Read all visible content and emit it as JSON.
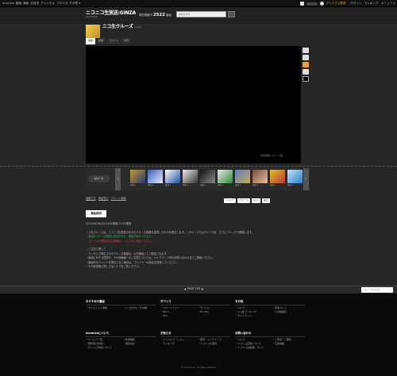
{
  "globalbar": {
    "left_links": [
      "niconico",
      "動画",
      "静画",
      "生放送",
      "チャンネル",
      "ブロマガ",
      "その他 ▾"
    ],
    "premium": "プレミアム登録",
    "login": "ログイン",
    "right_links": [
      "ログイン",
      "ランキング",
      "メニュー ▾"
    ]
  },
  "header": {
    "logo": "ニコニコ生放送:GINZA",
    "logo_sub": "nicolive β",
    "viewers_label": "現在視聴中",
    "viewers_count": "2522",
    "viewers_unit": "番組",
    "search_placeholder": "番組を探す"
  },
  "program": {
    "title": "ニコ生クルーズ",
    "title_sub": "(公式)",
    "meta": "",
    "tabs": [
      "番組",
      "詳細",
      "コメント",
      "共有"
    ]
  },
  "player": {
    "meta": "来場者数 コメント数"
  },
  "strip": {
    "lead_label": "番組一覧",
    "items": [
      {
        "cap": "番組 ▸",
        "c1": "#c79b2e",
        "c2": "#1e3a7a"
      },
      {
        "cap": "番組 ▸",
        "c1": "#3a60b8",
        "c2": "#e8e8ff"
      },
      {
        "cap": "番組 ▸",
        "c1": "#ffffff",
        "c2": "#2050a0"
      },
      {
        "cap": "番組 ▸",
        "c1": "#eeeeee",
        "c2": "#333333"
      },
      {
        "cap": "番組 ▸",
        "c1": "#111111",
        "c2": "#888888"
      },
      {
        "cap": "番組 ▸",
        "c1": "#e8e8e8",
        "c2": "#2e8a3a"
      },
      {
        "cap": "番組 ▸",
        "c1": "#5d7fb0",
        "c2": "#c9a86b"
      },
      {
        "cap": "番組 ▸",
        "c1": "#7a4a3a",
        "c2": "#e2c0a0"
      },
      {
        "cap": "番組 ▸",
        "c1": "#e2c12a",
        "c2": "#b73a3a"
      },
      {
        "cap": "番組 ▸",
        "c1": "#c8e0f8",
        "c2": "#2a80c8"
      }
    ]
  },
  "subnav": {
    "links": [
      "通報する",
      "番組表示",
      "コメント通報"
    ],
    "share": [
      "f シェア",
      "ツイート",
      "G+1",
      "設定"
    ]
  },
  "description": {
    "button": "番組説明",
    "lines": [
      {
        "t": "2013/08/26(月) 24:00開場 24:00開演",
        "c": ""
      },
      {
        "t": "",
        "c": ""
      },
      {
        "t": "ニコ生クルーズは、ニコニコ生放送の中からクルーズ候補を選択したものを配信します。このページではクルーズを、さらにクリックで移動します。",
        "c": ""
      },
      {
        "t": "・番組のクルーズ候補に参加すると、番組が紹介されます。",
        "c": "g"
      },
      {
        "t": "・クルーズの配信方法の詳細は、ヘルプをご確認ください。",
        "c": "r"
      },
      {
        "t": "",
        "c": ""
      },
      {
        "t": "・ご注意に関して",
        "c": ""
      },
      {
        "t": "・ランダムで再生されたクルーズ番組は、公式番組として配信されます。",
        "c": ""
      },
      {
        "t": "・番組に対する質問や、その他番組へのご意見については、ヘルプページ内のお問い合わせまでご連絡ください。",
        "c": ""
      },
      {
        "t": "・番組中のコメントを表示しない場合は、プレイヤーの設定を変更してください。",
        "c": ""
      },
      {
        "t": "・その他詳細に関してはヘルプをご覧ください。",
        "c": ""
      }
    ]
  },
  "pagetop": "▲ PAGE TOP ▲",
  "feedback": "フィードバック",
  "footer": {
    "cols": [
      {
        "title": "おすすめの番組",
        "items": [
          "タイムシフト番組",
          "ニコ生クルーズ(β版)"
        ]
      },
      {
        "title": "デバイス",
        "items": [
          "スマートフォン",
          "モバイル",
          "Wii U",
          "PS Vita",
          "3DS"
        ]
      },
      {
        "title": "その他",
        "items": [
          "ヘルプ",
          "配信ガイド",
          "ニコ生ランキング",
          "公式番組表",
          "ガイドライン"
        ]
      },
      {
        "title": "niconicoについて",
        "items": [
          "サービス一覧",
          "利用規約",
          "権利者の皆様へ",
          "運営会社",
          "サイトご利用について"
        ]
      },
      {
        "title": "お知らせ",
        "items": [
          "インフォメーション",
          "障害・メンテナンス",
          "ランキング",
          "ニコニコ大百科"
        ]
      },
      {
        "title": "お問い合わせ",
        "items": [
          "ヘルプ",
          "ご意見・ご要望",
          "ニコニコ広告について",
          "広告掲載",
          "ニコニコ生放送について"
        ]
      }
    ],
    "copyright": "© niconico inc. All rights reserved."
  }
}
